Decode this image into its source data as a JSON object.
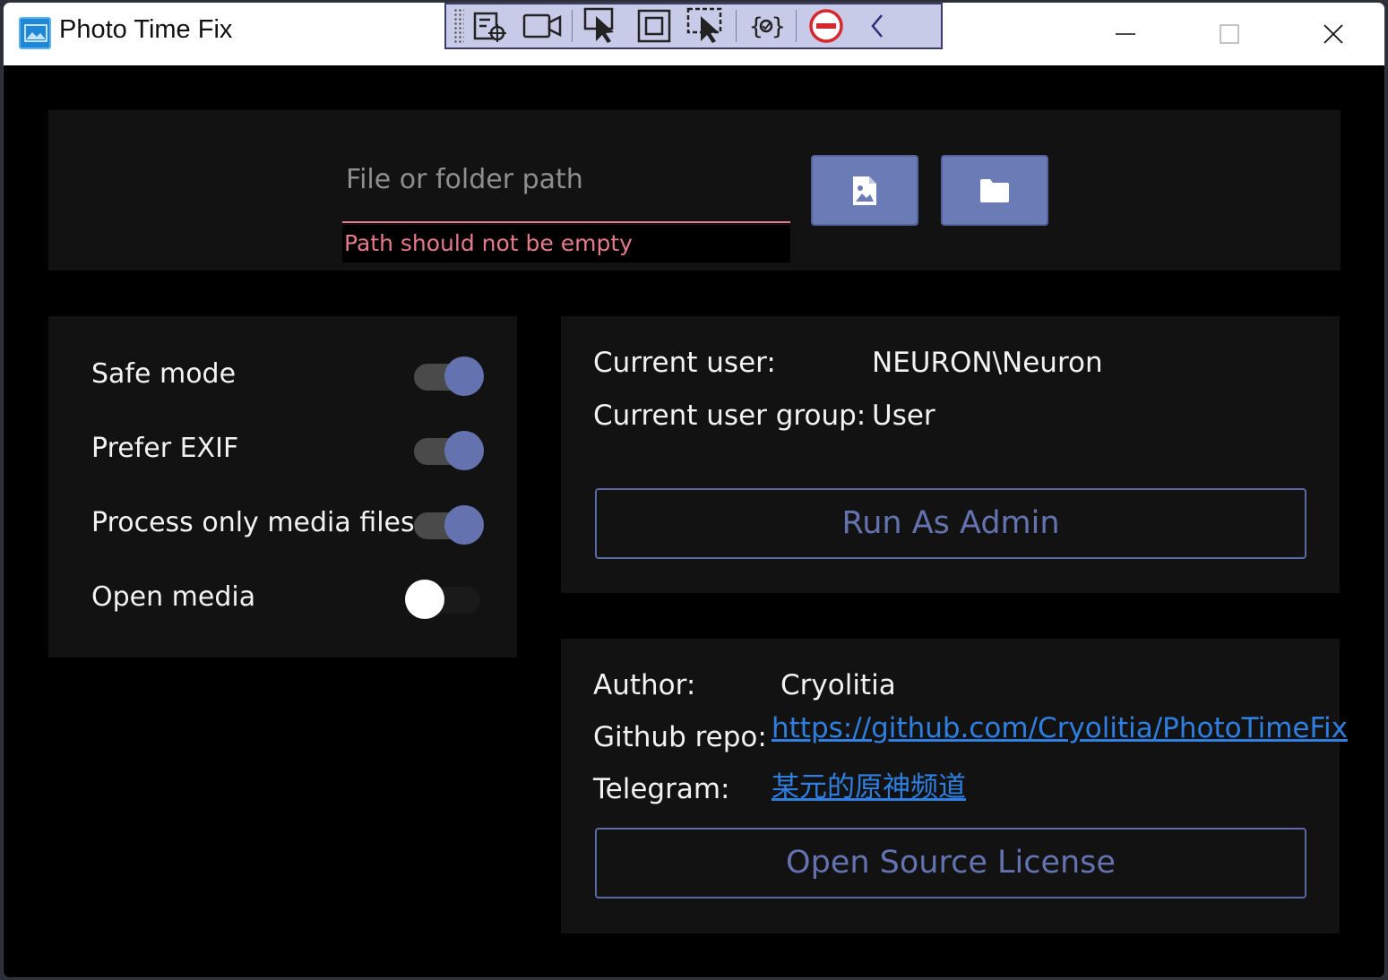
{
  "window": {
    "title": "Photo Time Fix",
    "controls": {
      "minimize_icon": "minimize-icon",
      "maximize_icon": "maximize-icon",
      "close_icon": "close-icon"
    }
  },
  "debug_toolbar": {
    "icons": [
      "grip-icon",
      "live-visual-tree-icon",
      "record-icon",
      "select-element-icon",
      "layout-adorner-icon",
      "track-focus-icon",
      "binding-failures-icon",
      "stop-icon",
      "collapse-icon"
    ]
  },
  "path": {
    "placeholder": "File or folder path",
    "value": "",
    "error": "Path should not be empty",
    "pick_file_icon": "image-file-icon",
    "pick_folder_icon": "folder-icon"
  },
  "options": [
    {
      "label": "Safe mode",
      "on": true
    },
    {
      "label": "Prefer EXIF",
      "on": true
    },
    {
      "label": "Process only media files",
      "on": true
    },
    {
      "label": "Open media",
      "on": false
    }
  ],
  "user": {
    "current_user_label": "Current user:",
    "current_user_value": "NEURON\\Neuron",
    "group_label": "Current user group:",
    "group_value": "User",
    "run_as_admin": "Run As Admin"
  },
  "about": {
    "author_label": "Author:",
    "author_value": "Cryolitia",
    "repo_label": "Github repo:",
    "repo_link": "https://github.com/Cryolitia/PhotoTimeFix",
    "telegram_label": "Telegram:",
    "telegram_link": "某元的原神频道",
    "license_button": "Open Source License"
  },
  "colors": {
    "accent": "#6473b0",
    "error": "#e57a8a",
    "link": "#2f7fe0",
    "card": "#121212",
    "background": "#000000"
  }
}
